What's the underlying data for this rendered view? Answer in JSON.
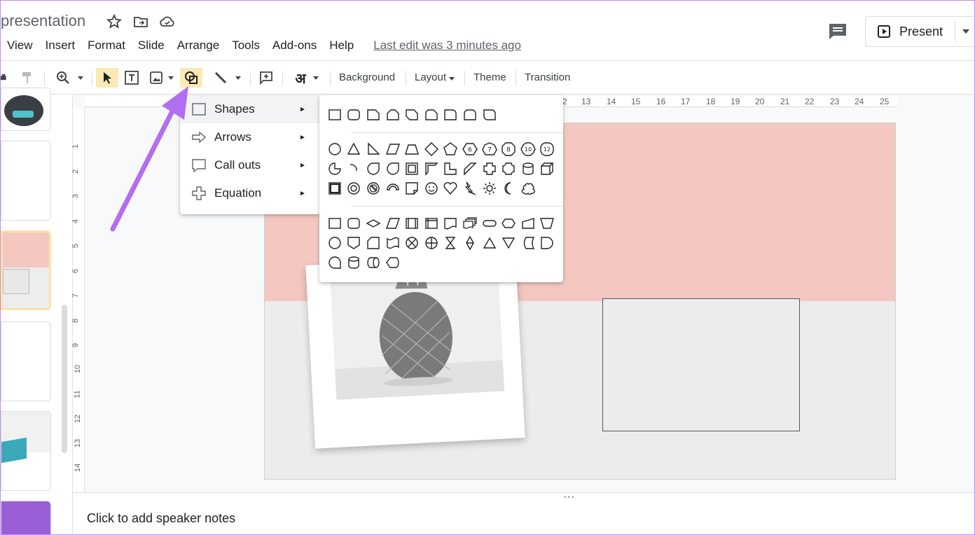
{
  "header": {
    "doc_title": "presentation",
    "menus": [
      "View",
      "Insert",
      "Format",
      "Slide",
      "Arrange",
      "Tools",
      "Add-ons",
      "Help"
    ],
    "last_edit": "Last edit was 3 minutes ago",
    "present_label": "Present"
  },
  "toolbar": {
    "input_tools_glyph": "अ",
    "background_label": "Background",
    "layout_label": "Layout",
    "theme_label": "Theme",
    "transition_label": "Transition"
  },
  "ruler": {
    "top_labels": [
      "2",
      "13",
      "14",
      "15",
      "16",
      "17",
      "18",
      "19",
      "20",
      "21",
      "22",
      "23",
      "24",
      "25"
    ],
    "left_labels": [
      "1",
      "2",
      "3",
      "4",
      "5",
      "6",
      "7",
      "8",
      "9",
      "10",
      "11",
      "12",
      "13",
      "14"
    ]
  },
  "insert_menu": {
    "items": [
      {
        "label": "Shapes",
        "icon": "square-icon"
      },
      {
        "label": "Arrows",
        "icon": "arrow-icon"
      },
      {
        "label": "Call outs",
        "icon": "callout-icon"
      },
      {
        "label": "Equation",
        "icon": "plus-icon"
      }
    ]
  },
  "shapes_submenu": {
    "octagon_numbers": [
      "6",
      "7",
      "8",
      "10",
      "12"
    ]
  },
  "speaker_notes": {
    "placeholder": "Click to add speaker notes"
  },
  "colors": {
    "accent_annotation": "#b26ef0",
    "slide_band": "#f4c7c1",
    "active_tool": "#fde9b5"
  }
}
